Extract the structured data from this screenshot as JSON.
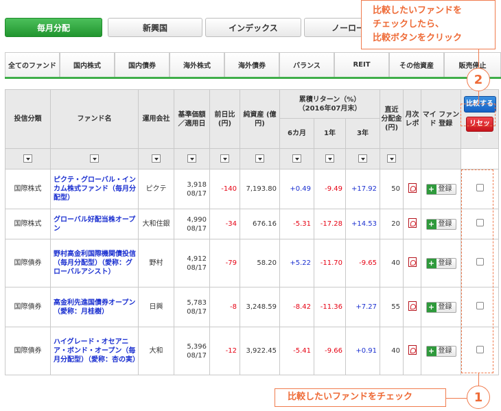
{
  "top_tabs": [
    {
      "label": "毎月分配",
      "active": true
    },
    {
      "label": "新興国",
      "active": false
    },
    {
      "label": "インデックス",
      "active": false
    },
    {
      "label": "ノーロード",
      "active": false
    }
  ],
  "sub_tabs": [
    "全てのファンド",
    "国内株式",
    "国内債券",
    "海外株式",
    "海外債券",
    "バランス",
    "REIT",
    "その他資産",
    "販売停止"
  ],
  "table": {
    "headers": {
      "category": "投信分類",
      "fund_name": "ファンド名",
      "company": "運用会社",
      "nav": "基準価額 ／適用日",
      "prev_day": "前日比 (円)",
      "net_assets": "純資産 (億円)",
      "cumulative_return": "累積リターン（%）",
      "return_asof": "（2016年07月末）",
      "m6": "6カ月",
      "y1": "1年",
      "y3": "3年",
      "dividend": "直近 分配金 (円)",
      "monthly_report": "月次 レポ",
      "my_fund": "マイ ファンド 登録"
    },
    "compare_button": "比較する",
    "reset_button": "リセット",
    "register_label": "登録",
    "rows": [
      {
        "category": "国際株式",
        "name": "ピクテ・グローバル・インカム株式ファンド（毎月分配型）",
        "company": "ピクテ",
        "nav": "3,918",
        "date": "08/17",
        "prev": "-140",
        "assets": "7,193.80",
        "m6": "+0.49",
        "y1": "-9.49",
        "y3": "+17.92",
        "dividend": "50"
      },
      {
        "category": "国際株式",
        "name": "グローバル好配当株オープン",
        "company": "大和住銀",
        "nav": "4,990",
        "date": "08/17",
        "prev": "-34",
        "assets": "676.16",
        "m6": "-5.31",
        "y1": "-17.28",
        "y3": "+14.53",
        "dividend": "20"
      },
      {
        "category": "国際債券",
        "name": "野村高金利国際機関債投信（毎月分配型）（愛称：グローバルアシスト）",
        "company": "野村",
        "nav": "4,912",
        "date": "08/17",
        "prev": "-79",
        "assets": "58.20",
        "m6": "+5.22",
        "y1": "-11.70",
        "y3": "-9.65",
        "dividend": "40"
      },
      {
        "category": "国際債券",
        "name": "高金利先進国債券オープン（愛称：月桂樹）",
        "company": "日興",
        "nav": "5,783",
        "date": "08/17",
        "prev": "-8",
        "assets": "3,248.59",
        "m6": "-8.42",
        "y1": "-11.36",
        "y3": "+7.27",
        "dividend": "55"
      },
      {
        "category": "国際債券",
        "name": "ハイグレード・オセアニア・ボンド・オープン（毎月分配型）（愛称：杏の実）",
        "company": "大和",
        "nav": "5,396",
        "date": "08/17",
        "prev": "-12",
        "assets": "3,922.45",
        "m6": "-5.41",
        "y1": "-9.66",
        "y3": "+0.91",
        "dividend": "40"
      }
    ]
  },
  "annotations": {
    "top_callout": "比較したいファンドを チェックしたら、 比較ボタンをクリック",
    "bottom_callout": "比較したいファンドをチェック",
    "step1": "1",
    "step2": "2"
  },
  "colors": {
    "active_tab": "#2ca63a",
    "accent_orange": "#ee6a36",
    "negative": "#e60012",
    "positive": "#1a2fd0",
    "compare_blue": "#1f73d6",
    "reset_red": "#e02a30"
  }
}
